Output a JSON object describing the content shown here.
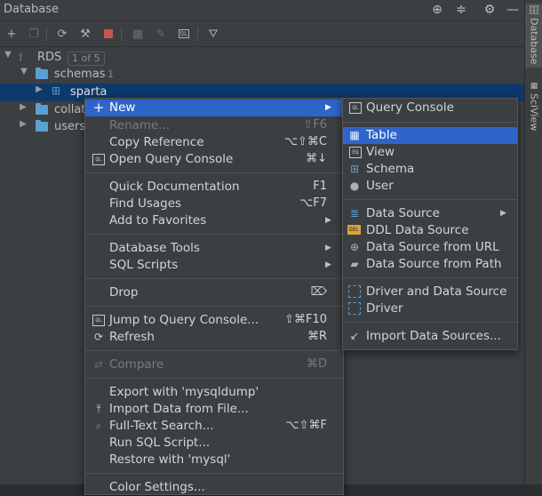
{
  "panel": {
    "title": "Database"
  },
  "tree": {
    "root": {
      "label": "RDS",
      "badge": "1 of 5"
    },
    "schemas": {
      "label": "schemas",
      "count": "1"
    },
    "sparta": {
      "label": "sparta"
    },
    "collations": {
      "label": "collati"
    },
    "users": {
      "label": "users"
    }
  },
  "side_tabs": {
    "database": "Database",
    "sciview": "SciView"
  },
  "context_menu": {
    "new": "New",
    "rename": "Rename...",
    "rename_sc": "⇧F6",
    "copy_ref": "Copy Reference",
    "copy_ref_sc": "⌥⇧⌘C",
    "open_console": "Open Query Console",
    "open_console_sc": "⌘↓",
    "quick_doc": "Quick Documentation",
    "quick_doc_sc": "F1",
    "find_usages": "Find Usages",
    "find_usages_sc": "⌥F7",
    "add_fav": "Add to Favorites",
    "db_tools": "Database Tools",
    "sql_scripts": "SQL Scripts",
    "drop": "Drop",
    "drop_sc": "⌦",
    "jump_console": "Jump to Query Console...",
    "jump_console_sc": "⇧⌘F10",
    "refresh": "Refresh",
    "refresh_sc": "⌘R",
    "compare": "Compare",
    "compare_sc": "⌘D",
    "export": "Export with 'mysqldump'",
    "import_file": "Import Data from File...",
    "fulltext": "Full-Text Search...",
    "fulltext_sc": "⌥⇧⌘F",
    "run_sql": "Run SQL Script...",
    "restore": "Restore with 'mysql'",
    "color": "Color Settings..."
  },
  "submenu": {
    "query_console": "Query Console",
    "table": "Table",
    "view": "View",
    "schema": "Schema",
    "user": "User",
    "data_source": "Data Source",
    "ddl_data_source": "DDL Data Source",
    "ds_url": "Data Source from URL",
    "ds_path": "Data Source from Path",
    "driver_ds": "Driver and Data Source",
    "driver": "Driver",
    "import_ds": "Import Data Sources..."
  },
  "colors": {
    "highlight": "#2f65ca",
    "selection": "#0d3a6b",
    "panel": "#3c3f41"
  }
}
